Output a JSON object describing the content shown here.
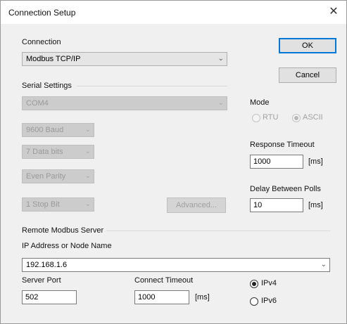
{
  "window": {
    "title": "Connection Setup",
    "close_glyph": "✕"
  },
  "connection": {
    "label": "Connection",
    "value": "Modbus TCP/IP"
  },
  "buttons": {
    "ok": "OK",
    "cancel": "Cancel",
    "advanced": "Advanced..."
  },
  "serial": {
    "label": "Serial Settings",
    "port": "COM4",
    "baud": "9600 Baud",
    "data_bits": "7 Data bits",
    "parity": "Even Parity",
    "stop_bits": "1 Stop Bit"
  },
  "mode": {
    "label": "Mode",
    "rtu": "RTU",
    "ascii": "ASCII",
    "selected": "ASCII"
  },
  "response_timeout": {
    "label": "Response Timeout",
    "value": "1000",
    "unit": "[ms]"
  },
  "delay_between_polls": {
    "label": "Delay Between Polls",
    "value": "10",
    "unit": "[ms]"
  },
  "remote": {
    "label": "Remote Modbus Server",
    "ip_label": "IP Address or Node Name",
    "ip_value": "192.168.1.6",
    "server_port_label": "Server Port",
    "server_port_value": "502",
    "connect_timeout_label": "Connect Timeout",
    "connect_timeout_value": "1000",
    "connect_timeout_unit": "[ms]",
    "ipv4": "IPv4",
    "ipv6": "IPv6",
    "ip_version_selected": "IPv4"
  },
  "icons": {
    "dropdown": "chevron-down-icon",
    "close": "close-icon"
  }
}
